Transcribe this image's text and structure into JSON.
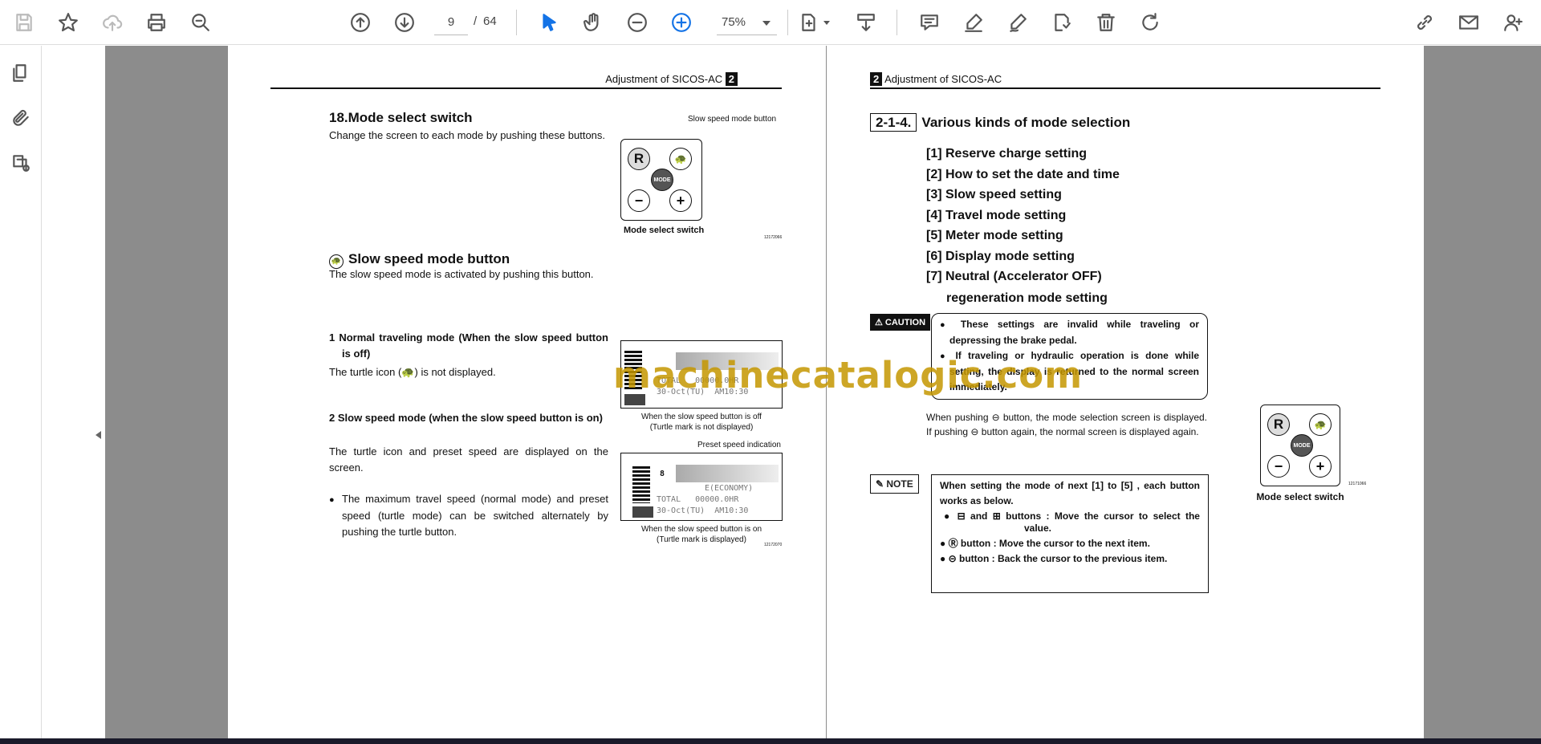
{
  "toolbar": {
    "page_current": "9",
    "page_separator": "/",
    "page_total": "64",
    "zoom": "75%",
    "icons": [
      "save-icon",
      "bookmark-star-icon",
      "upload-cloud-icon",
      "print-icon",
      "zoom-search-icon",
      "page-up-icon",
      "page-down-icon",
      "select-cursor-icon",
      "hand-pan-icon",
      "zoom-out-icon",
      "zoom-in-icon",
      "page-fit-icon",
      "scroll-mode-icon",
      "comment-icon",
      "highlight-pen-icon",
      "draw-icon",
      "stamp-icon",
      "delete-icon",
      "rotate-icon",
      "link-icon",
      "email-icon",
      "add-user-icon"
    ]
  },
  "sidebar": {
    "icons": [
      "thumbnails-icon",
      "attachment-icon",
      "signature-layers-icon"
    ]
  },
  "left_page": {
    "header": "Adjustment of SICOS-AC",
    "header_num": "2",
    "title": "18.Mode select switch",
    "intro": "Change the screen to each mode by pushing these buttons.",
    "callout_slow": "Slow speed mode button",
    "fig_caption": "Mode select switch",
    "btn_r": "R",
    "btn_mode": "MODE",
    "btn_minus": "−",
    "btn_plus": "+",
    "fig_code1": "12172066",
    "slow_title": "Slow speed mode button",
    "slow_text": "The slow speed mode is activated by pushing this button.",
    "item1_title": "1 Normal traveling mode (When the slow speed button is off)",
    "item1_text": "The turtle icon (",
    "item1_text2": ") is not displayed.",
    "lcd1_caption1": "When the slow speed button is off",
    "lcd1_caption2": "(Turtle mark is not displayed)",
    "item2_title": "2 Slow speed mode (when the slow speed button is on)",
    "item2_text": "The turtle icon and preset speed are displayed on the screen.",
    "bullet": "The maximum travel speed (normal mode) and preset speed (turtle mode) can be switched alternately by pushing the turtle button.",
    "preset_label": "Preset speed indication",
    "lcd2_caption1": "When the slow speed button is on",
    "lcd2_caption2": "(Turtle mark is displayed)",
    "fig_code2": "12172070",
    "lcd_rows": {
      "a": "E(ECONOMY)",
      "b": "TOTAL   00000.0HR",
      "c": "30-Oct(TU)  AM10:30",
      "d": "8"
    }
  },
  "right_page": {
    "header": "Adjustment of SICOS-AC",
    "header_num": "2",
    "section_num": "2-1-4.",
    "section_title": "Various kinds of mode selection",
    "items": [
      "[1] Reserve charge setting",
      "[2] How to set the date and time",
      "[3] Slow speed setting",
      "[4] Travel mode setting",
      "[5] Meter mode setting",
      "[6] Display mode setting",
      "[7] Neutral (Accelerator OFF)",
      "regeneration  mode setting"
    ],
    "caution_label": "CAUTION",
    "caution1": "These settings are invalid while traveling or depressing the brake pedal.",
    "caution2": "If traveling or hydraulic operation is done while setting, the display is returned to the normal screen immediately.",
    "para_a": "When pushing",
    "para_b": "button, the mode selection screen is displayed. If pushing",
    "para_c": "button again, the normal screen is displayed again.",
    "note_label": "NOTE",
    "note_intro": "When setting the mode of next [1] to [5] , each button works as below.",
    "note_and": "and",
    "note1": "buttons : Move the cursor to select the value.",
    "note2": "button : Move the cursor to the next item.",
    "note3": "button : Back the cursor to the previous item.",
    "fig_caption": "Mode select switch",
    "fig_code": "12171066"
  },
  "watermark": "machinecatalogic.com"
}
